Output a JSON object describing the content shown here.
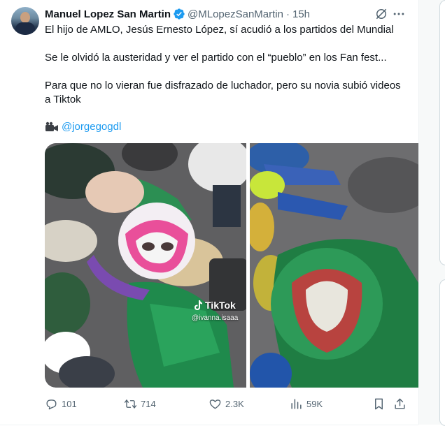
{
  "tweet": {
    "display_name": "Manuel Lopez San Martin",
    "handle": "@MLopezSanMartin",
    "separator": "·",
    "time": "15h",
    "paragraphs": [
      "El hijo de AMLO, Jesús Ernesto López, sí acudió a los partidos del Mundial",
      "Se le olvidó la austeridad y ver el partido con el “pueblo” en los Fan fest...",
      "Para que no lo vieran fue disfrazado de luchador, pero su novia subió videos a Tiktok"
    ],
    "mention": "@jorgegogdl",
    "media": {
      "watermark_brand": "TikTok",
      "watermark_user": "@ivanna.isaaa"
    },
    "actions": {
      "replies": "101",
      "reposts": "714",
      "likes": "2.3K",
      "views": "59K"
    }
  },
  "colors": {
    "accent": "#1d9bf0",
    "muted": "#536471",
    "text": "#0f1419",
    "mexico_green": "#1f8a4c"
  },
  "icons": [
    "verified-badge-icon",
    "grok-icon",
    "more-icon",
    "camera-icon",
    "reply-icon",
    "retweet-icon",
    "like-icon",
    "views-icon",
    "bookmark-icon",
    "share-icon",
    "tiktok-icon"
  ]
}
